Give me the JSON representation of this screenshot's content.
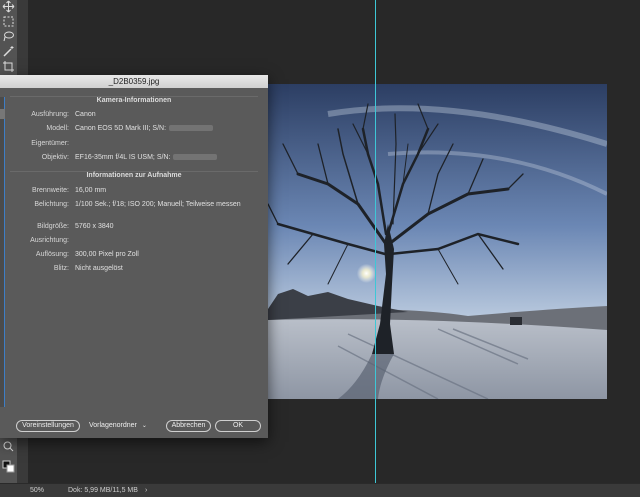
{
  "dialog": {
    "title": "_D2B0359.jpg",
    "camera_section": "Kamera-Informationen",
    "camera_rows": [
      {
        "label": "Ausführung:",
        "value": "Canon"
      },
      {
        "label": "Modell:",
        "value": "Canon EOS 5D Mark III;  S/N:"
      },
      {
        "label": "Eigentümer:",
        "value": ""
      },
      {
        "label": "Objektiv:",
        "value": "EF16-35mm f/4L IS USM;  S/N:"
      }
    ],
    "shot_section": "Informationen zur Aufnahme",
    "shot_rows": [
      {
        "label": "Brennweite:",
        "value": "16,00 mm"
      },
      {
        "label": "Belichtung:",
        "value": "1/100 Sek.;  f/18;  ISO 200;  Manuell;  Teilweise messen"
      },
      {
        "label": "Bildgröße:",
        "value": "5760 x 3840"
      },
      {
        "label": "Ausrichtung:",
        "value": ""
      },
      {
        "label": "Auflösung:",
        "value": "300,00 Pixel pro Zoll"
      },
      {
        "label": "Blitz:",
        "value": "Nicht ausgelöst"
      }
    ],
    "buttons": {
      "preferences": "Voreinstellungen",
      "template_folder": "Vorlagenordner",
      "cancel": "Abbrechen",
      "ok": "OK"
    }
  },
  "statusbar": {
    "zoom": "50%",
    "doc": "Dok: 5,99 MB/11,5 MB",
    "arrow": "›"
  },
  "colors": {
    "guide": "#3ec7d6",
    "dialog_bg": "#5a5a5a",
    "workspace_bg": "#282828"
  }
}
